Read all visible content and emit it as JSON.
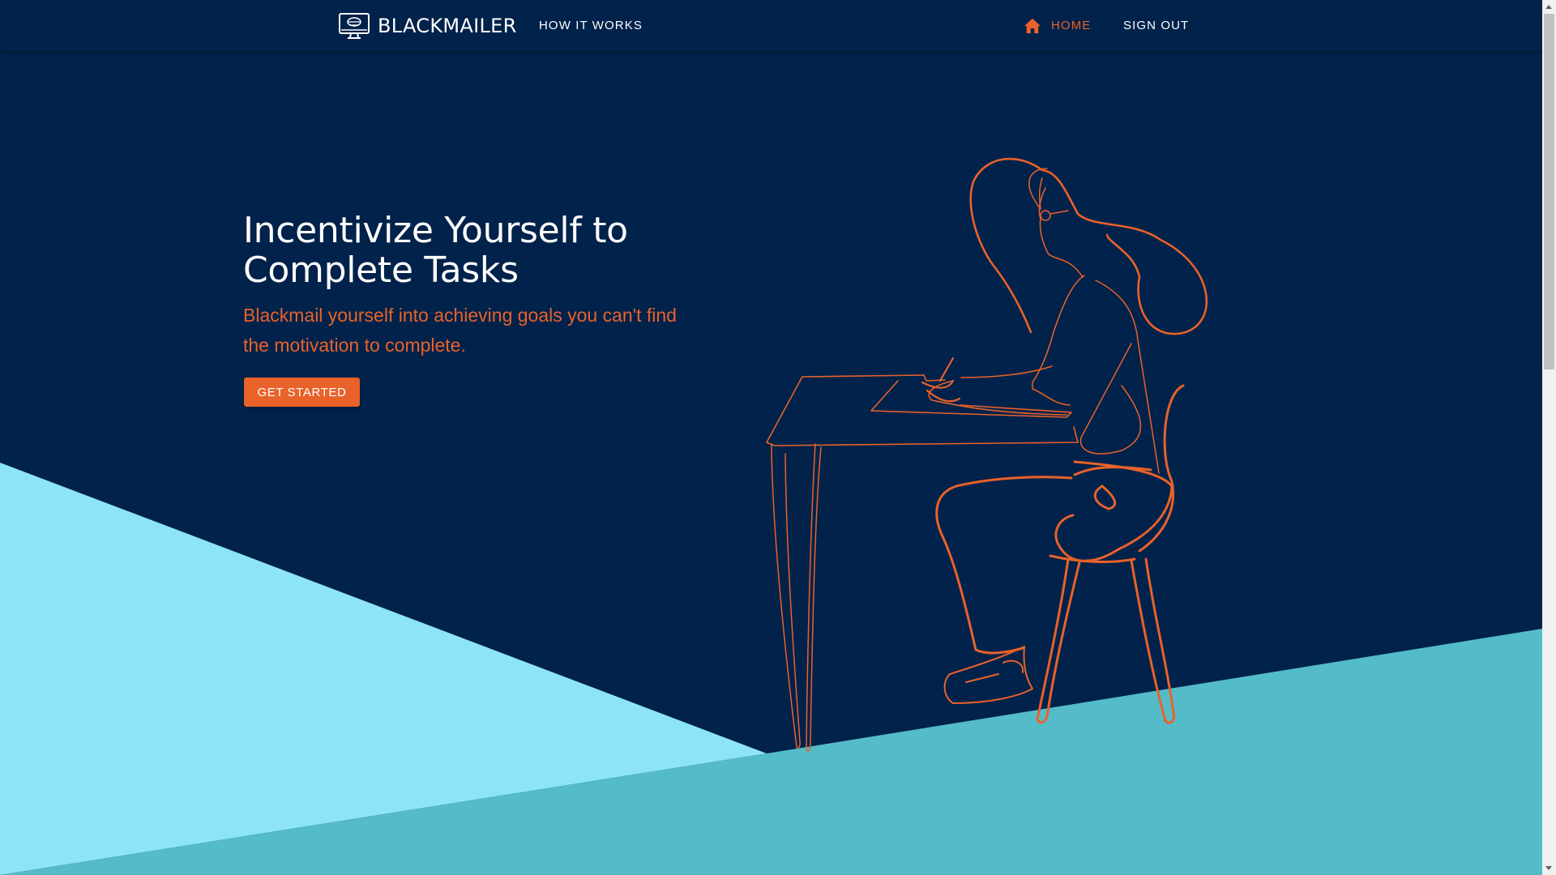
{
  "navbar": {
    "brand": "BLACKMAILER",
    "how_it_works": "HOW IT WORKS",
    "home": "HOME",
    "sign_out": "SIGN OUT"
  },
  "hero": {
    "title": "Incentivize Yourself to Complete Tasks",
    "subtitle": "Blackmail yourself into achieving goals you can't find the motivation to complete.",
    "cta": "GET STARTED"
  },
  "icons": {
    "brand": "monitor-logo-icon",
    "home": "home-icon",
    "illustration": "woman-writing-at-desk-illustration"
  },
  "colors": {
    "background": "#01224a",
    "accent": "#e8622a",
    "light_cyan": "#8ce4f4",
    "teal": "#54bbc9",
    "text": "#ffffff"
  }
}
